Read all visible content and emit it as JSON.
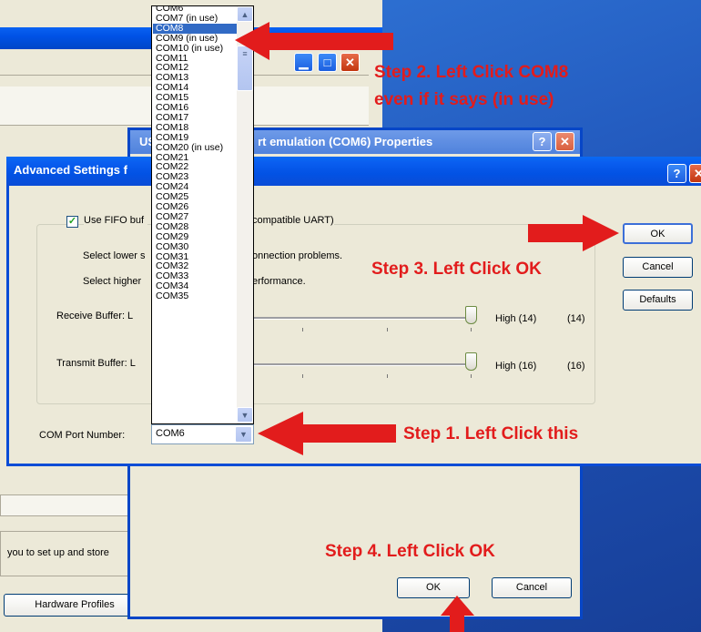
{
  "background_window": {
    "description_text": "you to set up and store",
    "hardware_profiles_button": "Hardware Profiles"
  },
  "properties_window": {
    "title": "USB Serial Port emulation (COM6) Properties",
    "title_visible_left": "US",
    "title_visible_right": "rt emulation (COM6) Properties",
    "ok_label": "OK",
    "cancel_label": "Cancel"
  },
  "advanced_dialog": {
    "title": "Advanced Settings f",
    "fifo_label_a": "Use FIFO buf",
    "fifo_label_b": "compatible UART)",
    "fifo_checked": true,
    "lower_a": "Select lower s",
    "lower_b": "onnection problems.",
    "higher_a": "Select higher",
    "higher_b": "erformance.",
    "receive_label": "Receive Buffer:  L",
    "transmit_label": "Transmit Buffer:  L",
    "receive_high": "High (14)",
    "receive_value": "(14)",
    "transmit_high": "High (16)",
    "transmit_value": "(16)",
    "ok_label": "OK",
    "cancel_label": "Cancel",
    "defaults_label": "Defaults",
    "com_port_label": "COM Port Number:",
    "com_port_value": "COM6"
  },
  "com_dropdown": {
    "items": [
      "COM6",
      "COM7 (in use)",
      "COM8",
      "COM9 (in use)",
      "COM10 (in use)",
      "COM11",
      "COM12",
      "COM13",
      "COM14",
      "COM15",
      "COM16",
      "COM17",
      "COM18",
      "COM19",
      "COM20 (in use)",
      "COM21",
      "COM22",
      "COM23",
      "COM24",
      "COM25",
      "COM26",
      "COM27",
      "COM28",
      "COM29",
      "COM30",
      "COM31",
      "COM32",
      "COM33",
      "COM34",
      "COM35"
    ],
    "selected": "COM8"
  },
  "annotations": {
    "step2_line1": "Step 2. Left Click COM8",
    "step2_line2": "even if it says (in use)",
    "step3": "Step 3. Left Click OK",
    "step1": "Step 1. Left Click this",
    "step4": "Step 4. Left Click OK",
    "color": "#e21c1c"
  },
  "colors": {
    "titlebar_blue": "#0a5ef0",
    "selection_blue": "#316ac5",
    "dialog_bg": "#ece9d8",
    "desktop_blue": "#1f53b8"
  }
}
